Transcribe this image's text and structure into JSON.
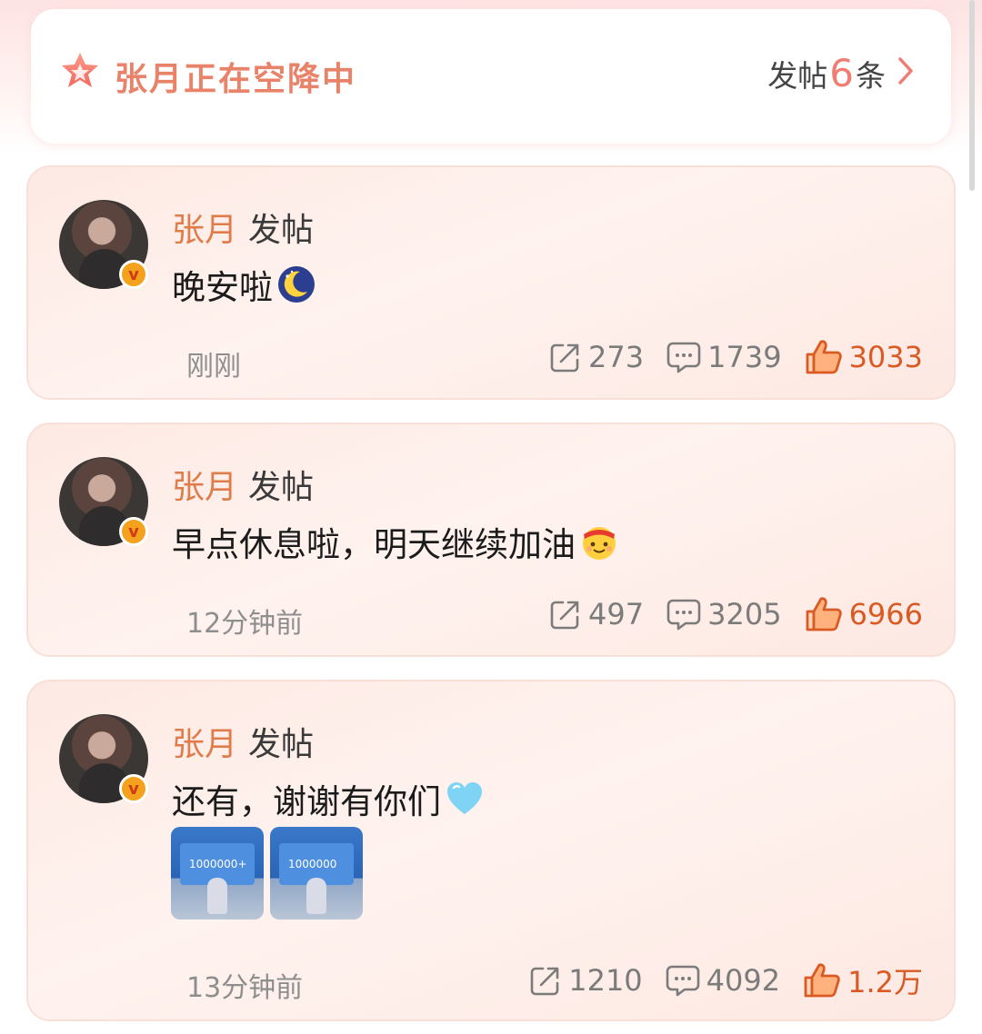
{
  "banner": {
    "title": "张月正在空降中",
    "count_prefix": "发帖",
    "count": "6",
    "count_suffix": "条"
  },
  "posts": [
    {
      "author": "张月",
      "action": "发帖",
      "text": "晚安啦",
      "emoji": "moon-emoji",
      "time": "刚刚",
      "reposts": "273",
      "comments": "1739",
      "likes": "3033"
    },
    {
      "author": "张月",
      "action": "发帖",
      "text": "早点休息啦，明天继续加油",
      "emoji": "cheer-emoji",
      "time": "12分钟前",
      "reposts": "497",
      "comments": "3205",
      "likes": "6966"
    },
    {
      "author": "张月",
      "action": "发帖",
      "text": "还有，谢谢有你们",
      "emoji": "blue-heart-emoji",
      "time": "13分钟前",
      "reposts": "1210",
      "comments": "4092",
      "likes": "1.2万",
      "images": [
        {
          "caption": "1000000+"
        },
        {
          "caption": "1000000"
        }
      ]
    }
  ],
  "colors": {
    "accent": "#e8836a",
    "author": "#e07c4a",
    "like": "#d95a23",
    "verified": "#f4a11d"
  }
}
